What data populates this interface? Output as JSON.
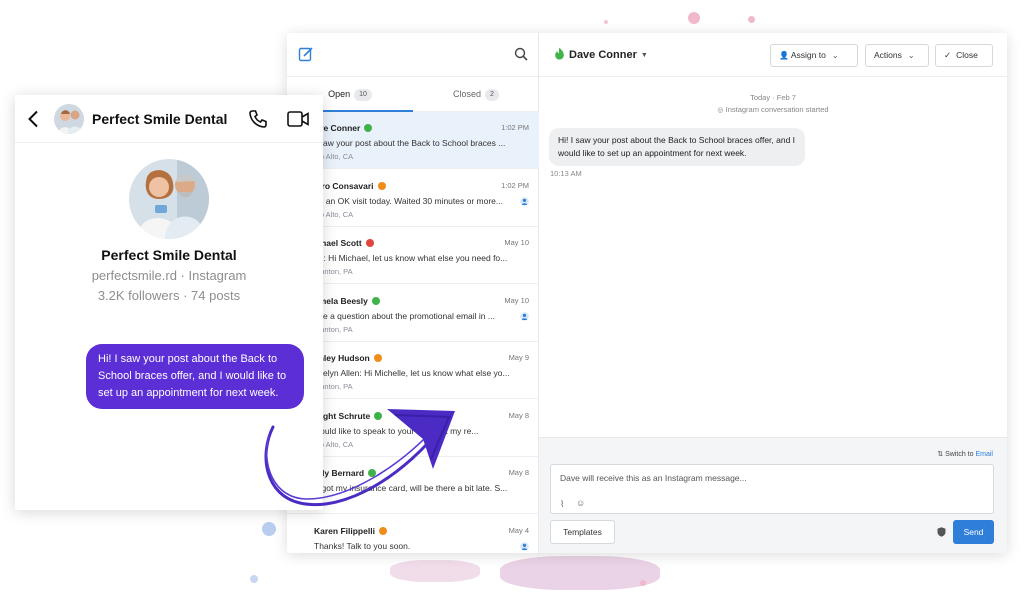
{
  "inbox": {
    "tabs": [
      {
        "label": "Open",
        "count": "10"
      },
      {
        "label": "Closed",
        "count": "2"
      }
    ],
    "conversations": [
      {
        "name": "ave Conner",
        "time": "1:02 PM",
        "preview": "I saw your post about the Back to School braces ...",
        "location": "alo Alto, CA",
        "badge_color": "#3fb24a",
        "badge": "",
        "agent": false
      },
      {
        "name": "etro Consavari",
        "time": "1:02 PM",
        "preview": "ad an OK visit today. Waited 30 minutes or more...",
        "location": "alo Alto, CA",
        "badge_color": "#f08c1a",
        "badge": "",
        "agent": true
      },
      {
        "name": "ichael Scott",
        "time": "May 10",
        "preview": "ou: Hi Michael, let us know what else you need fo...",
        "location": "cranton, PA",
        "badge_color": "#e0463b",
        "badge": "",
        "agent": false
      },
      {
        "name": "amela Beesly",
        "time": "May 10",
        "preview": "ave a question about the promotional email in ...",
        "location": "cranton, PA",
        "badge_color": "#3fb24a",
        "badge": "",
        "agent": true
      },
      {
        "name": "anley Hudson",
        "time": "May 9",
        "preview": "evelyn Allen: Hi Michelle, let us know what else yo...",
        "location": "cranton, PA",
        "badge_color": "#f08c1a",
        "badge": "",
        "agent": false
      },
      {
        "name": "wight Schrute",
        "time": "May 8",
        "preview": "would like to speak to your           er about my re...",
        "location": "alo Alto, CA",
        "badge_color": "#3fb24a",
        "badge": "",
        "agent": false
      },
      {
        "name": "ndy Bernard",
        "time": "May 8",
        "preview": "orgot my insurance card, will be there a bit late. S...",
        "location": "",
        "badge_color": "#3fb24a",
        "badge": "",
        "agent": false
      },
      {
        "name": "Karen Filippelli",
        "time": "May 4",
        "preview": "Thanks! Talk to you soon.",
        "location": "",
        "badge_color": "#f08c1a",
        "badge": "",
        "agent": true
      }
    ]
  },
  "thread": {
    "contact_name": "Dave Conner",
    "assign_label": "Assign to",
    "actions_label": "Actions",
    "close_label": "Close",
    "day_label": "Today · Feb 7",
    "started_label": "Instagram conversation started",
    "message": "Hi! I saw your post about the Back to School braces offer, and I would like to set up an appointment for next week.",
    "message_time": "10:13 AM",
    "switch_prefix": "Switch to",
    "switch_channel": "Email",
    "composer_placeholder": "Dave will receive this as an Instagram message...",
    "templates_label": "Templates",
    "send_label": "Send"
  },
  "instagram": {
    "title": "Perfect Smile Dental",
    "profile_name": "Perfect Smile Dental",
    "handle": "perfectsmile.rd · Instagram",
    "stats": "3.2K followers · 74 posts",
    "message": "Hi! I saw your post about the Back to School braces offer, and I would like to set up an appointment for next week.",
    "bubble_color": "#5b2ed6"
  }
}
